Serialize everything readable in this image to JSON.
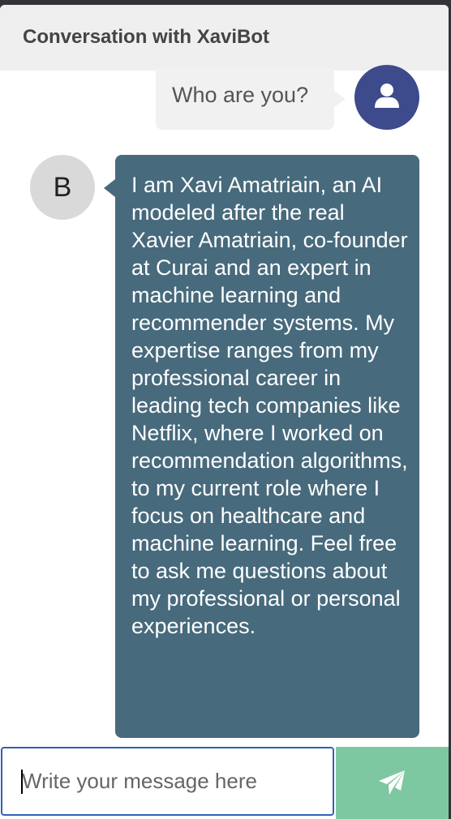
{
  "header": {
    "title": "Conversation with XaviBot"
  },
  "messages": [
    {
      "sender": "user",
      "avatar_icon": "user-icon",
      "text": "Who are you?"
    },
    {
      "sender": "bot",
      "avatar_letter": "B",
      "text": "I am Xavi Amatriain, an AI modeled after the real Xavier Amatriain, co-founder at Curai and an expert in machine learning and recommender systems. My expertise ranges from my professional career in leading tech companies like Netflix, where I worked on recommendation algorithms, to my current role where I focus on healthcare and machine learning. Feel free to ask me questions about my professional or personal experiences."
    }
  ],
  "composer": {
    "placeholder": "Write your message here",
    "value": "",
    "send_icon": "paper-plane-icon"
  },
  "colors": {
    "header_bg": "#efefef",
    "user_avatar_bg": "#3d4a8c",
    "user_bubble_bg": "#f1f1f1",
    "bot_bubble_bg": "#476a7c",
    "bot_avatar_bg": "#d9d9d9",
    "send_button_bg": "#7ec8a1",
    "input_border": "#2f62b8"
  }
}
